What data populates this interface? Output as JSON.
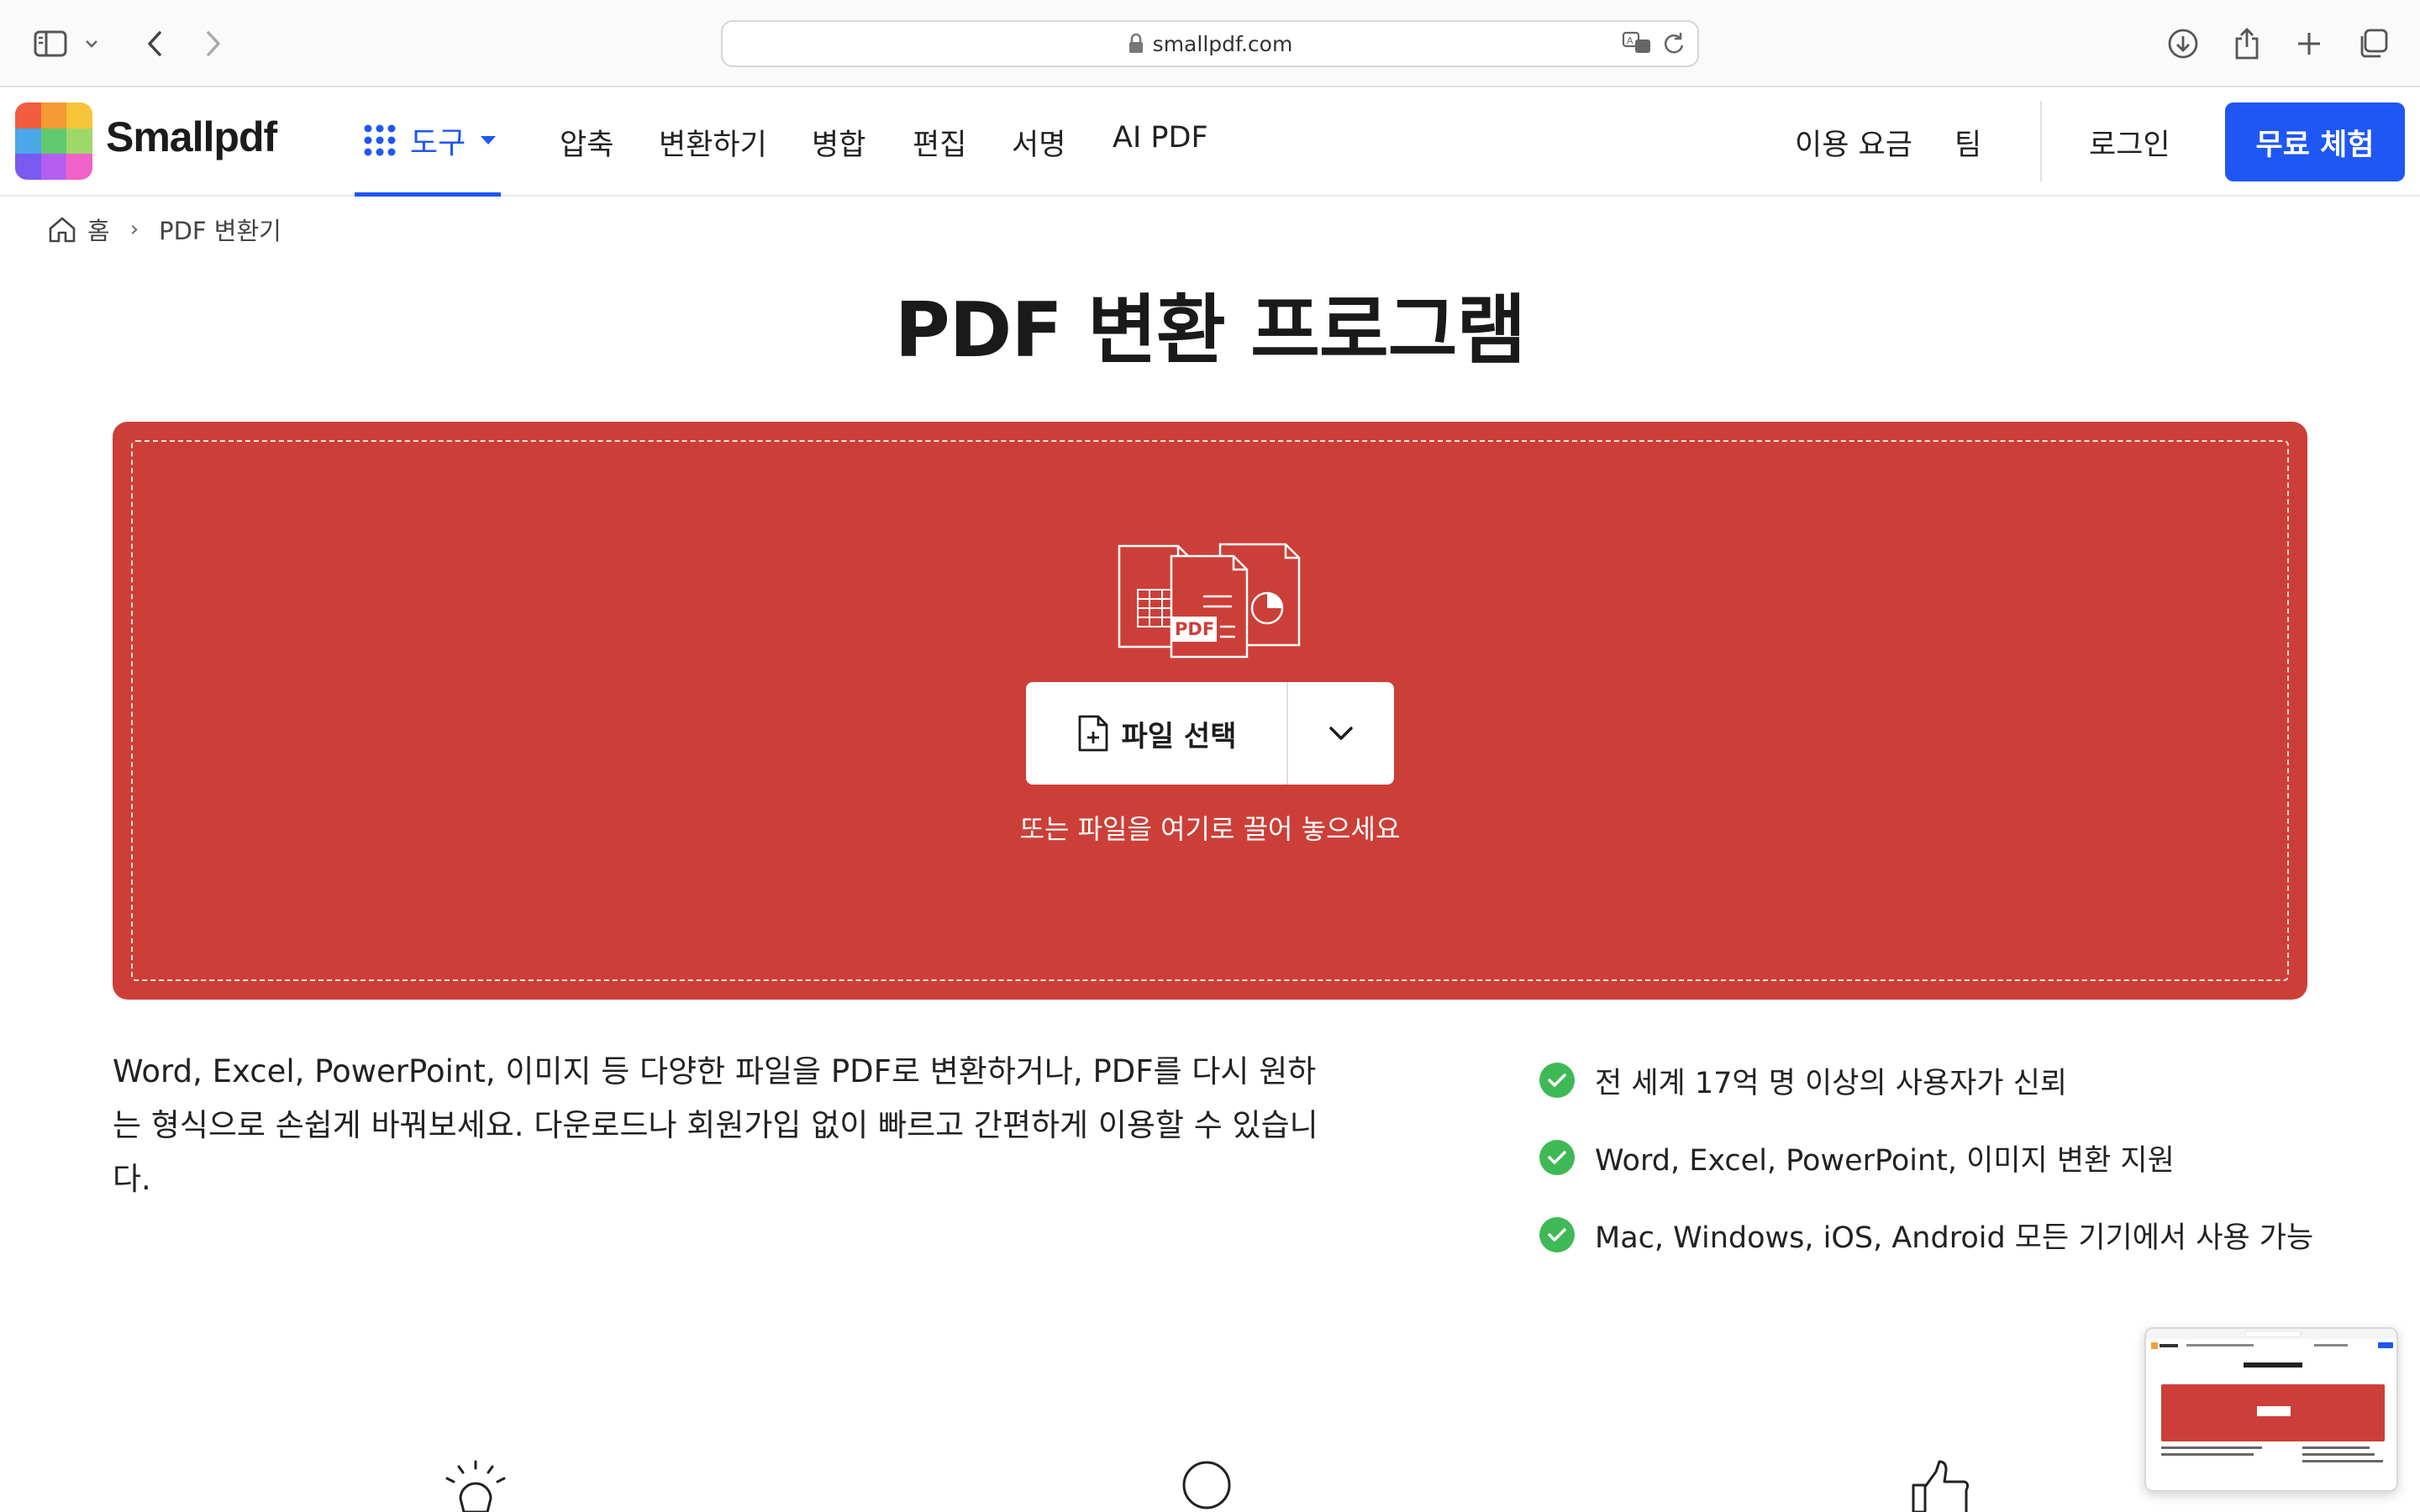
{
  "browser": {
    "url": "smallpdf.com"
  },
  "nav": {
    "brand": "Smallpdf",
    "tools_label": "도구",
    "links": [
      "압축",
      "변환하기",
      "병합",
      "편집",
      "서명",
      "AI PDF"
    ],
    "pricing": "이용 요금",
    "team": "팀",
    "login": "로그인",
    "cta": "무료 체험"
  },
  "breadcrumb": {
    "home": "홈",
    "separator": "›",
    "current": "PDF 변환기"
  },
  "page": {
    "title": "PDF 변환 프로그램"
  },
  "dropzone": {
    "illustration_label": "PDF",
    "select_button": "파일 선택",
    "hint": "또는 파일을 여기로 끌어 놓으세요"
  },
  "description": "Word, Excel, PowerPoint, 이미지 등 다양한 파일을 PDF로 변환하거나, PDF를 다시 원하는 형식으로 손쉽게 바꿔보세요. 다운로드나 회원가입 없이 빠르고 간편하게 이용할 수 있습니다.",
  "features": [
    "전 세계 17억 명 이상의 사용자가 신뢰",
    "Word, Excel, PowerPoint, 이미지 변환 지원",
    "Mac, Windows, iOS, Android 모든 기기에서 사용 가능"
  ],
  "colors": {
    "accent": "#1f57f5",
    "dropzone": "#cc3f38",
    "check": "#3fb955"
  }
}
